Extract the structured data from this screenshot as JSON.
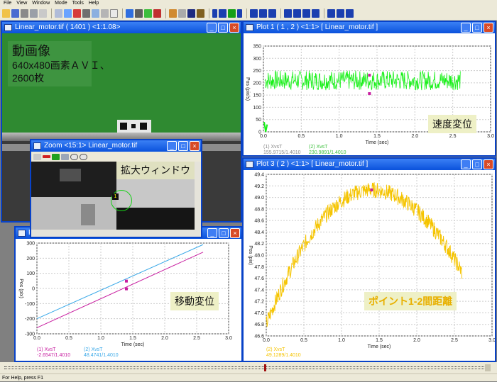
{
  "menu": [
    "File",
    "View",
    "Window",
    "Mode",
    "Tools",
    "Help"
  ],
  "colors": {
    "green": "#17f017",
    "yellow": "#f5c400",
    "magenta": "#c81ea0",
    "cyan": "#38a8e8",
    "note_bg": "#eef0c6"
  },
  "icons": [
    "open-icon",
    "save-icon",
    "print-icon",
    "copy-icon",
    "paste-icon",
    "zoom-icon",
    "measure-icon",
    "help-icon",
    "stop-icon",
    "play-icon",
    "rewind-icon",
    "forward-icon",
    "step-back-icon",
    "step-forward-icon"
  ],
  "video_win": {
    "title": "Linear_motor.tif ( 1401 ) <1:1.08>",
    "note_l1": "動画像",
    "note_l2": "640x480画素ＡＶＩ、",
    "note_l3": "2600枚"
  },
  "zoom_win": {
    "title": "Zoom <15:1> Linear_motor.tif",
    "note": "拡大ウィンドウ",
    "marker": "1"
  },
  "plot1_win": {
    "title": "Plot 1 ( 1 , 2 ) <1:1> [ Linear_motor.tif ]",
    "note": "速度変位",
    "ylabel": "Pos (pix/s)",
    "xlabel": "Time (sec)",
    "leg1_name": "(1) XvsT",
    "leg1_val": "155.9715/1.4010",
    "leg2_name": "(2) XvsT",
    "leg2_val": "230.9891/1.4010"
  },
  "plot2_win": {
    "title": "Pl",
    "note": "移動変位",
    "ylabel": "Pos (pix)",
    "xlabel": "Time (sec)",
    "leg1_name": "(1) XvsT",
    "leg1_val": "-2.6547/1.4010",
    "leg2_name": "(2) XvsT",
    "leg2_val": "48.4741/1.4010"
  },
  "plot3_win": {
    "title": "Plot 3 ( 2 ) <1:1> [ Linear_motor.tif ]",
    "note": "ポイント1-2間距離",
    "ylabel": "Pos (pix)",
    "xlabel": "Time (sec)",
    "leg1_name": "(2) XvsT",
    "leg1_val": "49.1289/1.4010"
  },
  "status": "For Help, press F1",
  "chart_data": [
    {
      "type": "line",
      "id": "plot1",
      "xlim": [
        0,
        3
      ],
      "ylim": [
        0,
        350
      ],
      "xticks": [
        "0.0",
        "0.5",
        "1.0",
        "1.5",
        "2.0",
        "2.5",
        "3.0"
      ],
      "yticks": [
        "0",
        "50",
        "100",
        "150",
        "200",
        "250",
        "300",
        "350"
      ],
      "series": [
        {
          "name": "(2) XvsT",
          "mean": 210,
          "band": [
            170,
            250
          ],
          "x_end": 2.6
        }
      ],
      "markers": [
        {
          "x": 1.4,
          "y": 231
        },
        {
          "x": 1.4,
          "y": 156
        }
      ]
    },
    {
      "type": "line",
      "id": "plot2",
      "xlim": [
        0,
        3
      ],
      "ylim": [
        -300,
        300
      ],
      "xticks": [
        "0.0",
        "0.5",
        "1.0",
        "1.5",
        "2.0",
        "2.5",
        "3.0"
      ],
      "yticks": [
        "-300",
        "-200",
        "-100",
        "0",
        "100",
        "200",
        "300"
      ],
      "series": [
        {
          "name": "(2) XvsT",
          "x": [
            0,
            2.6
          ],
          "y": [
            -200,
            290
          ]
        },
        {
          "name": "(1) XvsT",
          "x": [
            0,
            2.6
          ],
          "y": [
            -260,
            240
          ]
        }
      ],
      "markers": [
        {
          "x": 1.4,
          "y": 48.5
        },
        {
          "x": 1.4,
          "y": -2.7
        }
      ]
    },
    {
      "type": "line",
      "id": "plot3",
      "xlim": [
        0,
        3
      ],
      "ylim": [
        46.6,
        49.4
      ],
      "xticks": [
        "0.0",
        "0.5",
        "1.0",
        "1.5",
        "2.0",
        "2.5",
        "3.0"
      ],
      "yticks": [
        "46.6",
        "46.8",
        "47.0",
        "47.2",
        "47.4",
        "47.6",
        "47.8",
        "48.0",
        "48.2",
        "48.4",
        "48.6",
        "48.8",
        "49.0",
        "49.2",
        "49.4"
      ],
      "series": [
        {
          "name": "(2) XvsT",
          "peak_x": 1.4,
          "peak_y": 49.13,
          "y_start": 46.8,
          "y_end": 47.7,
          "x_end": 2.6
        }
      ],
      "markers": [
        {
          "x": 1.4,
          "y": 49.13
        }
      ]
    }
  ]
}
